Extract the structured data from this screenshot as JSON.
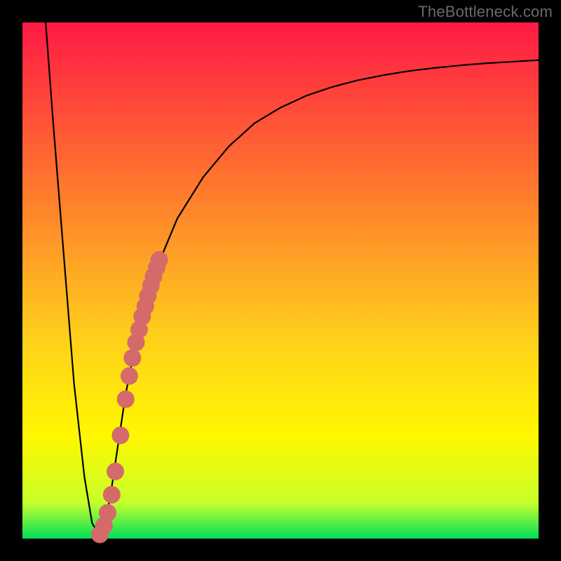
{
  "watermark": "TheBottleneck.com",
  "colors": {
    "black": "#000000",
    "curve": "#000000",
    "marker": "#d46a6a",
    "grad_top": "#ff1a44",
    "grad_mid1": "#ff8a2a",
    "grad_mid2": "#ffd21a",
    "grad_mid3": "#fff700",
    "grad_mid4": "#c8ff2a",
    "grad_bottom": "#00e05a"
  },
  "chart_data": {
    "type": "line",
    "title": "",
    "xlabel": "",
    "ylabel": "",
    "x_range": [
      0,
      100
    ],
    "y_range": [
      0,
      100
    ],
    "curve": {
      "x": [
        4.5,
        6,
        8,
        10,
        12,
        13.5,
        15,
        16,
        17,
        18.5,
        20,
        22,
        25,
        30,
        35,
        40,
        45,
        50,
        55,
        60,
        65,
        70,
        75,
        80,
        85,
        90,
        95,
        100
      ],
      "y": [
        100,
        80,
        55,
        30,
        12,
        3,
        0.5,
        3,
        8,
        18,
        28,
        38,
        50,
        62,
        70,
        76,
        80.5,
        83.5,
        85.8,
        87.5,
        88.8,
        89.8,
        90.6,
        91.2,
        91.7,
        92.1,
        92.4,
        92.7
      ]
    },
    "markers": {
      "x": [
        15.0,
        15.8,
        16.5,
        17.3,
        18.0,
        19.0,
        20.0,
        20.7,
        21.3,
        22.0,
        22.6,
        23.2,
        23.8,
        24.3,
        24.9,
        25.4,
        26.0,
        26.5
      ],
      "y": [
        0.8,
        2.5,
        5.0,
        8.5,
        13.0,
        20.0,
        27.0,
        31.5,
        35.0,
        38.0,
        40.5,
        43.0,
        45.0,
        47.0,
        49.0,
        50.8,
        52.5,
        54.0
      ]
    },
    "marker_radius_data_units": 1.7
  }
}
